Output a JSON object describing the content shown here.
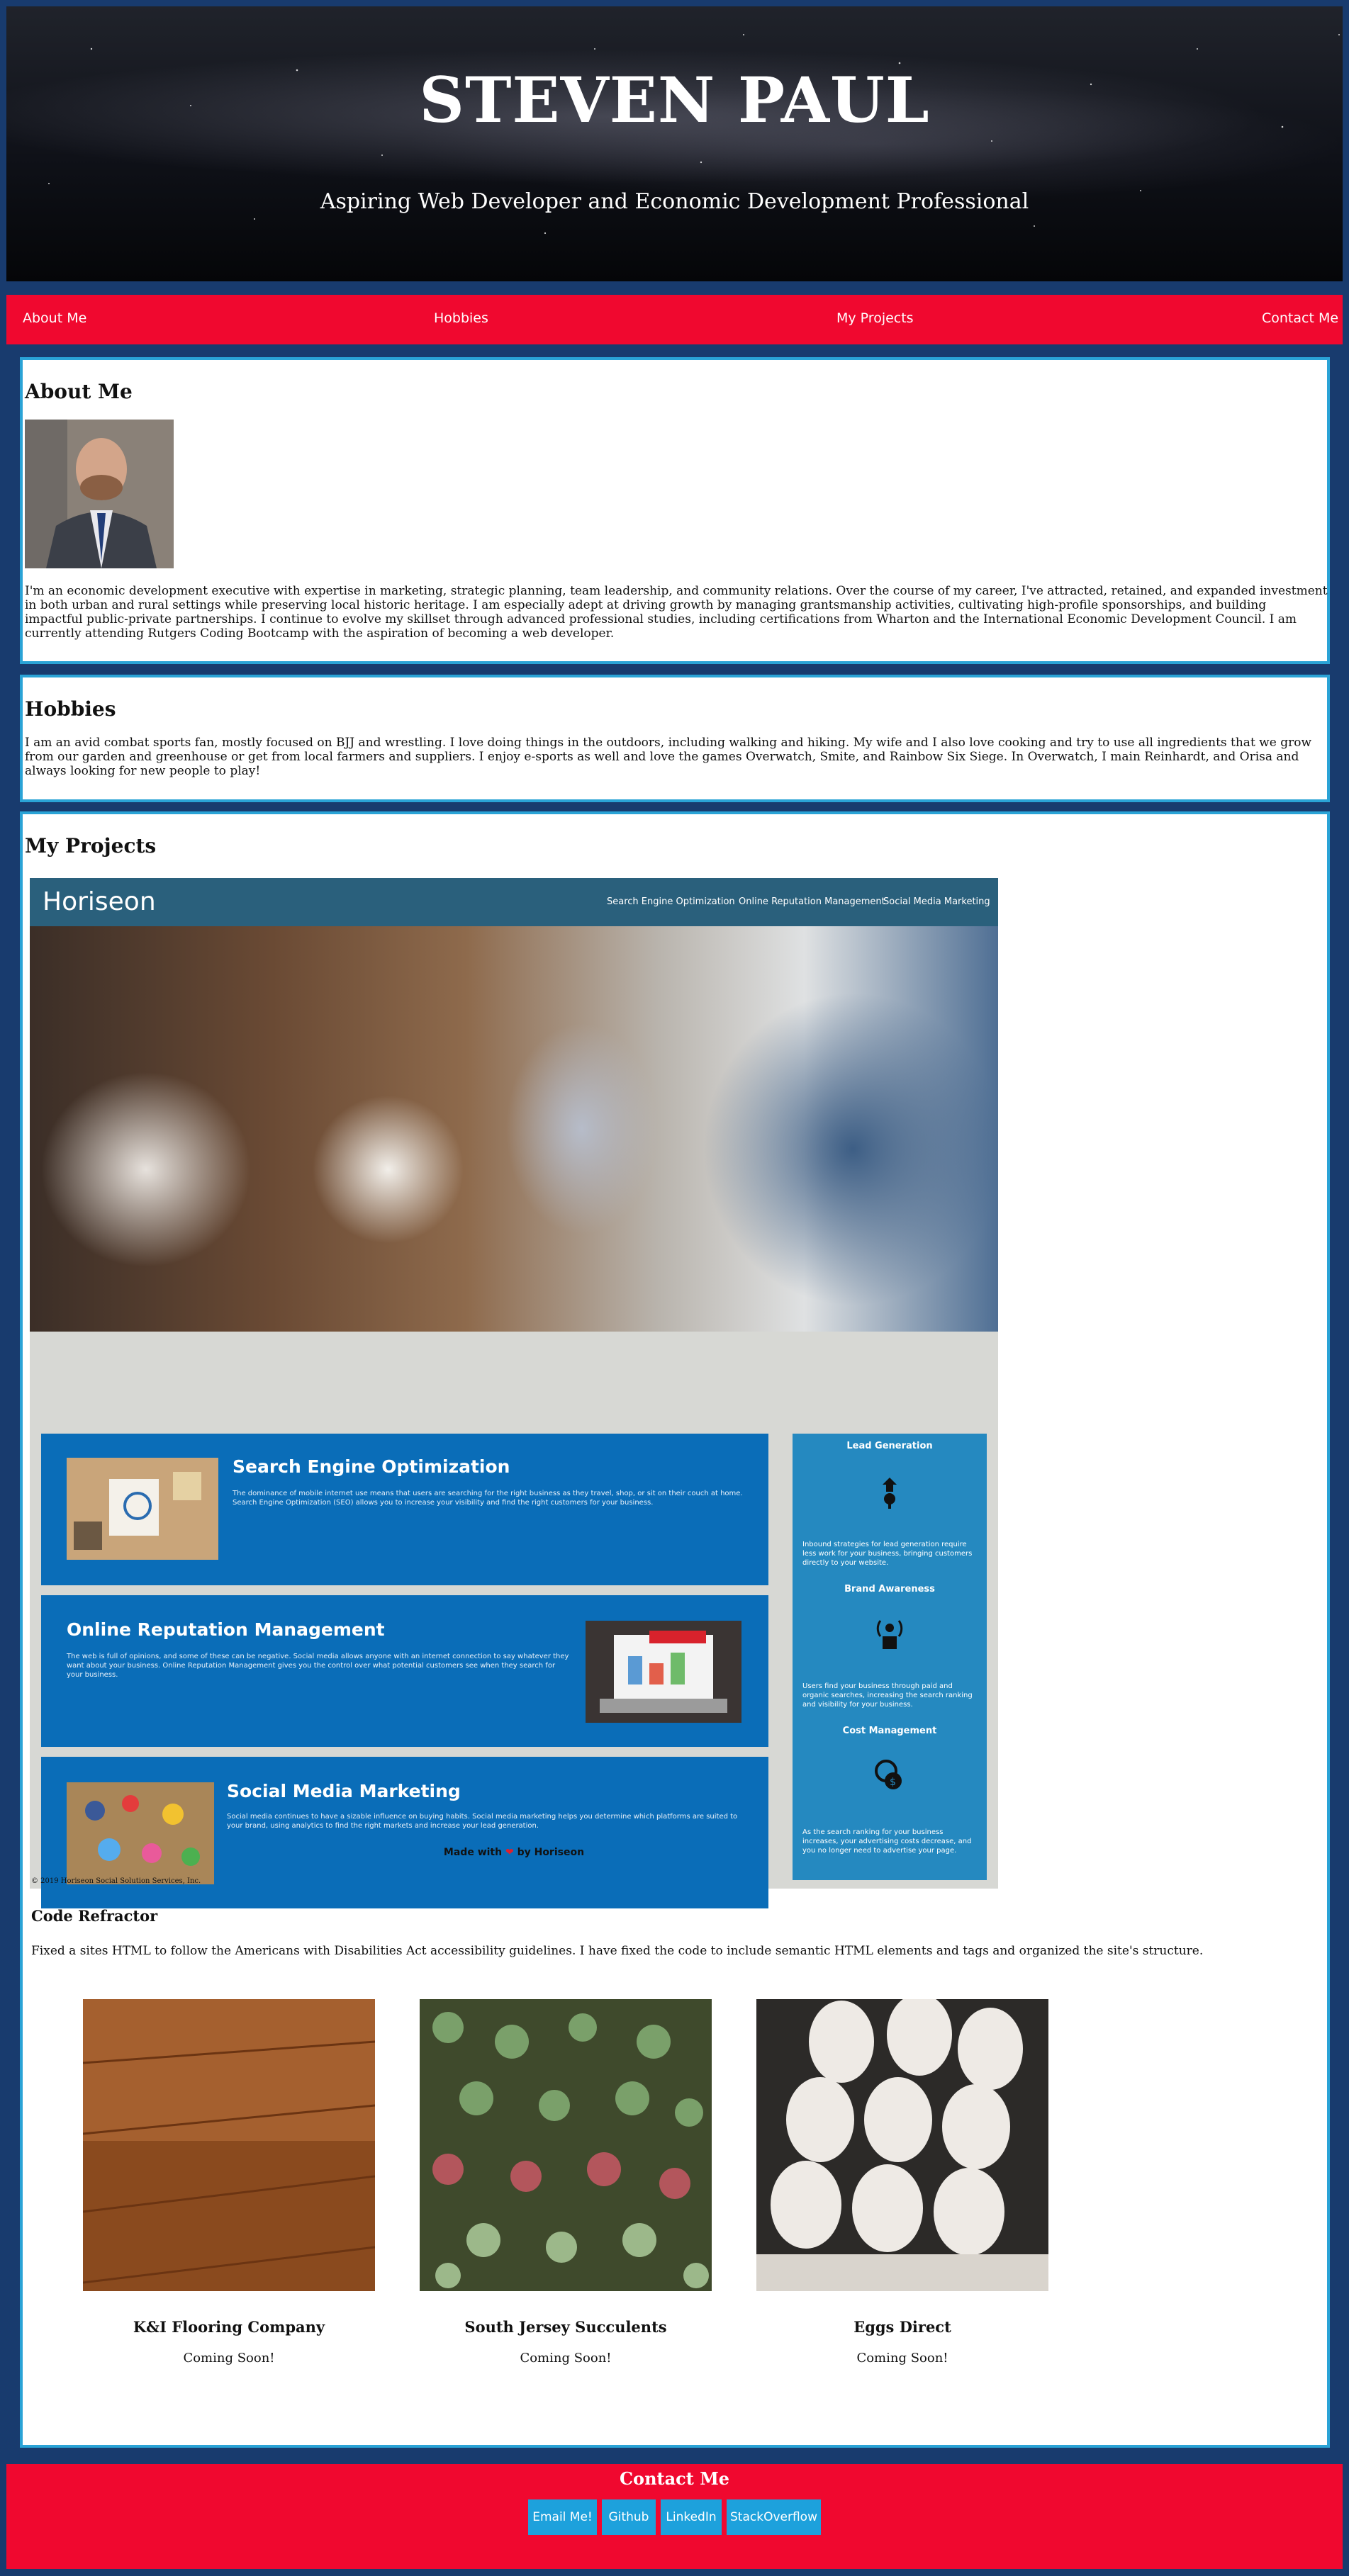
{
  "header": {
    "name": "STEVEN PAUL",
    "tagline": "Aspiring Web Developer and Economic Development Professional"
  },
  "nav": {
    "items": [
      "About Me",
      "Hobbies",
      "My Projects",
      "Contact Me"
    ]
  },
  "about": {
    "title": "About Me",
    "photo_icon": "profile-photo",
    "text": "I'm an economic development executive with expertise in marketing, strategic planning, team leadership, and community relations. Over the course of my career, I've attracted, retained, and expanded investment in both urban and rural settings while preserving local historic heritage. I am especially adept at driving growth by managing grantsmanship activities, cultivating high-profile sponsorships, and building impactful public-private partnerships. I continue to evolve my skillset through advanced professional studies, including certifications from Wharton and the International Economic Development Council. I am currently attending Rutgers Coding Bootcamp with the aspiration of becoming a web developer."
  },
  "hobbies": {
    "title": "Hobbies",
    "text": "I am an avid combat sports fan, mostly focused on BJJ and wrestling. I love doing things in the outdoors, including walking and hiking. My wife and I also love cooking and try to use all ingredients that we grow from our garden and greenhouse or get from local farmers and suppliers. I enjoy e-sports as well and love the games Overwatch, Smite, and Rainbow Six Siege. In Overwatch, I main Reinhardt, and Orisa and always looking for new people to play!"
  },
  "projects": {
    "title": "My Projects",
    "horiseon": {
      "logo": "Horiseon",
      "nav": [
        "Search Engine Optimization",
        "Online Reputation Management",
        "Social Media Marketing"
      ],
      "boxes": [
        {
          "title": "Search Engine Optimization",
          "text": "The dominance of mobile internet use means that users are searching for the right business as they travel, shop, or sit on their couch at home. Search Engine Optimization (SEO) allows you to increase your visibility and find the right customers for your business."
        },
        {
          "title": "Online Reputation Management",
          "text": "The web is full of opinions, and some of these can be negative. Social media allows anyone with an internet connection to say whatever they want about your business. Online Reputation Management gives you the control over what potential customers see when they search for your business."
        },
        {
          "title": "Social Media Marketing",
          "text": "Social media continues to have a sizable influence on buying habits. Social media marketing helps you determine which platforms are suited to your brand, using analytics to find the right markets and increase your lead generation."
        }
      ],
      "side": [
        {
          "title": "Lead Generation",
          "text": "Inbound strategies for lead generation require less work for your business, bringing customers directly to your website."
        },
        {
          "title": "Brand Awareness",
          "text": "Users find your business through paid and organic searches, increasing the search ranking and visibility for your business."
        },
        {
          "title": "Cost Management",
          "text": "As the search ranking for your business increases, your advertising costs decrease, and you no longer need to advertise your page."
        }
      ],
      "footer": {
        "before": "Made with",
        "heart": "❤",
        "after": "by Horiseon"
      },
      "copyright": "© 2019 Horiseon Social Solution Services, Inc."
    },
    "refactor_title": "Code Refractor",
    "refactor_text": "Fixed a sites HTML to follow the Americans with Disabilities Act accessibility guidelines. I have fixed the code to include semantic HTML elements and tags and organized the site's structure.",
    "upcoming": [
      {
        "name": "K&I Flooring Company",
        "status": "Coming Soon!"
      },
      {
        "name": "South Jersey Succulents",
        "status": "Coming Soon!"
      },
      {
        "name": "Eggs Direct",
        "status": "Coming Soon!"
      }
    ]
  },
  "contact": {
    "title": "Contact Me",
    "buttons": [
      "Email Me!",
      "Github",
      "LinkedIn",
      "StackOverflow"
    ]
  },
  "colors": {
    "background": "#183b6e",
    "nav": "#f0082f",
    "card_border": "#2aa3d6",
    "button": "#1da1dc",
    "horiseon_blue": "#0a6db8"
  }
}
